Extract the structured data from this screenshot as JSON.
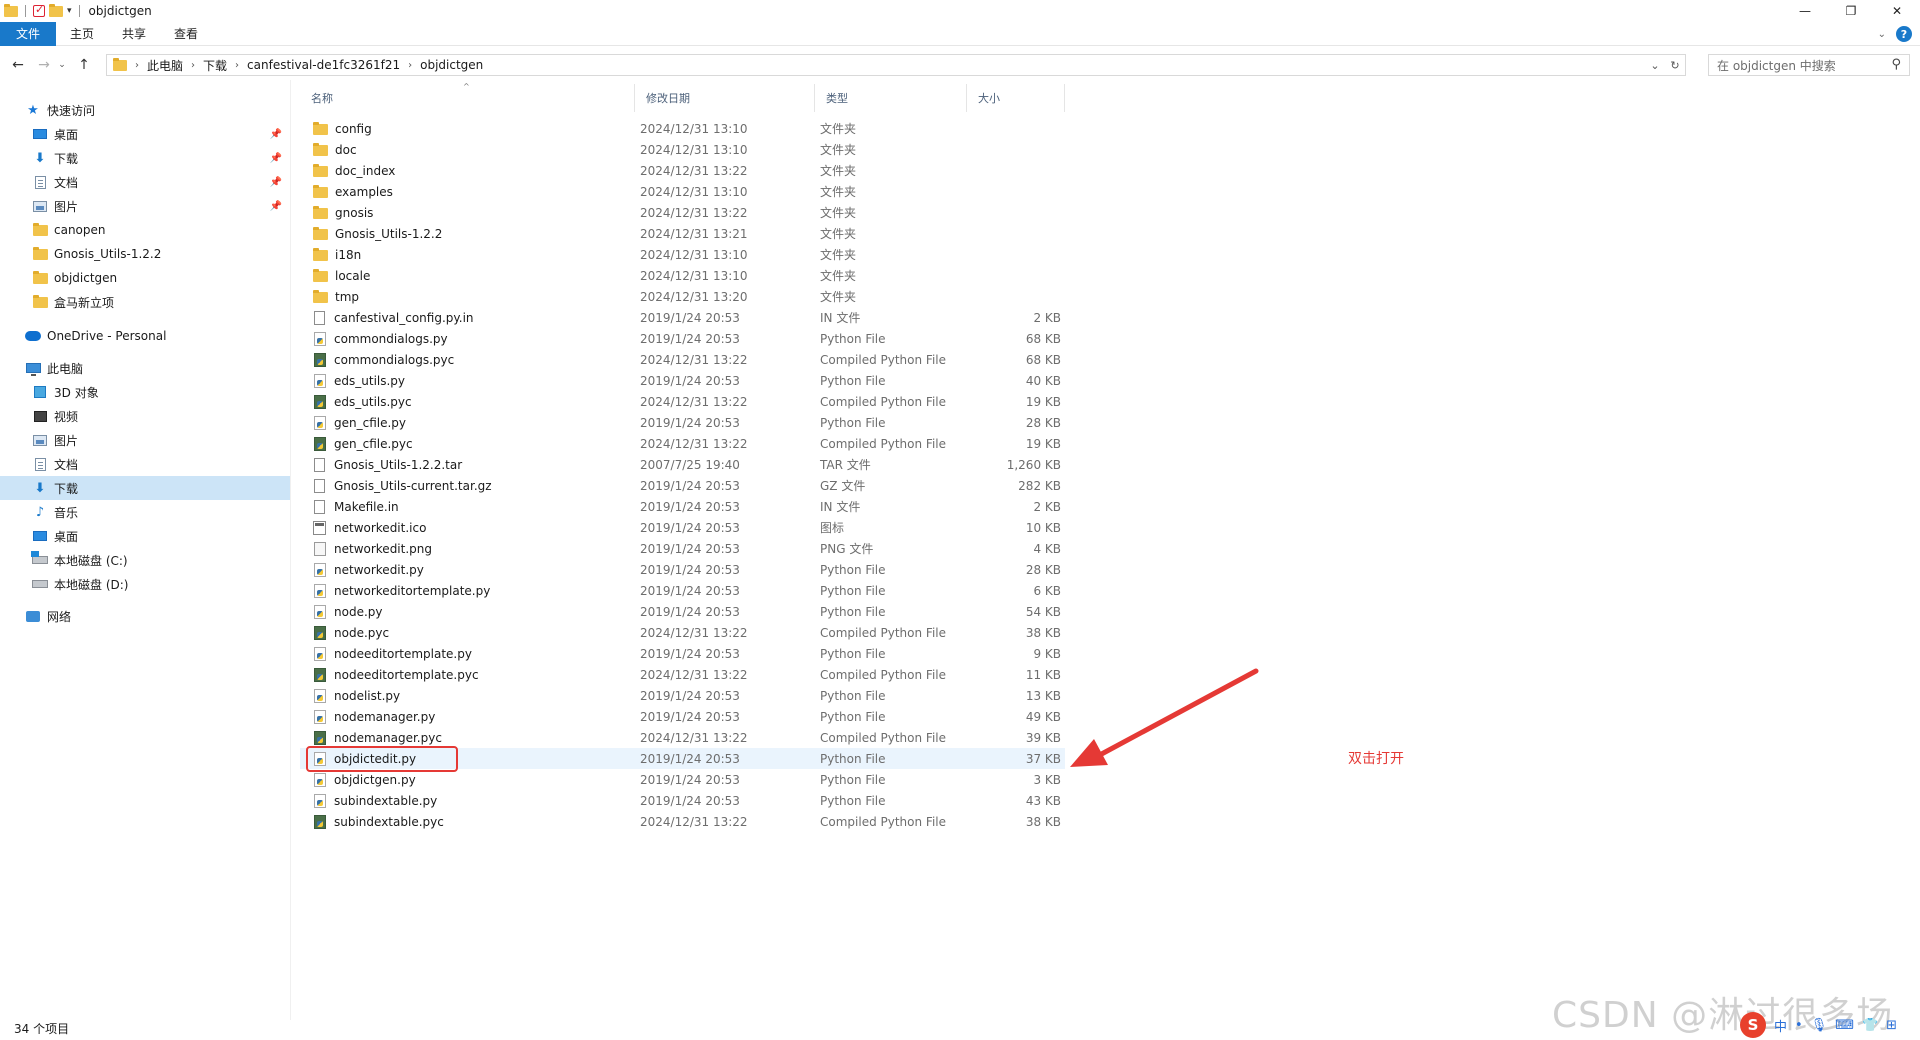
{
  "window": {
    "title": "objdictgen"
  },
  "window_controls": {
    "minimize": "—",
    "restore": "❐",
    "close": "✕"
  },
  "ribbon": {
    "tabs": [
      "文件",
      "主页",
      "共享",
      "查看"
    ],
    "help": "?"
  },
  "address": {
    "crumbs": [
      "此电脑",
      "下载",
      "canfestival-de1fc3261f21",
      "objdictgen"
    ]
  },
  "search": {
    "placeholder": "在 objdictgen 中搜索"
  },
  "sidebar": {
    "quick_access": "快速访问",
    "quick_items": [
      "桌面",
      "下载",
      "文档",
      "图片",
      "canopen",
      "Gnosis_Utils-1.2.2",
      "objdictgen",
      "盒马新立项"
    ],
    "onedrive": "OneDrive - Personal",
    "this_pc": "此电脑",
    "pc_items": [
      "3D 对象",
      "视频",
      "图片",
      "文档",
      "下载",
      "音乐",
      "桌面",
      "本地磁盘 (C:)",
      "本地磁盘 (D:)"
    ],
    "network": "网络"
  },
  "columns": {
    "name": "名称",
    "date": "修改日期",
    "type": "类型",
    "size": "大小"
  },
  "files": [
    {
      "name": "config",
      "date": "2024/12/31 13:10",
      "type": "文件夹",
      "size": "",
      "icon": "folder"
    },
    {
      "name": "doc",
      "date": "2024/12/31 13:10",
      "type": "文件夹",
      "size": "",
      "icon": "folder"
    },
    {
      "name": "doc_index",
      "date": "2024/12/31 13:22",
      "type": "文件夹",
      "size": "",
      "icon": "folder"
    },
    {
      "name": "examples",
      "date": "2024/12/31 13:10",
      "type": "文件夹",
      "size": "",
      "icon": "folder"
    },
    {
      "name": "gnosis",
      "date": "2024/12/31 13:22",
      "type": "文件夹",
      "size": "",
      "icon": "folder"
    },
    {
      "name": "Gnosis_Utils-1.2.2",
      "date": "2024/12/31 13:21",
      "type": "文件夹",
      "size": "",
      "icon": "folder"
    },
    {
      "name": "i18n",
      "date": "2024/12/31 13:10",
      "type": "文件夹",
      "size": "",
      "icon": "folder"
    },
    {
      "name": "locale",
      "date": "2024/12/31 13:10",
      "type": "文件夹",
      "size": "",
      "icon": "folder"
    },
    {
      "name": "tmp",
      "date": "2024/12/31 13:20",
      "type": "文件夹",
      "size": "",
      "icon": "folder"
    },
    {
      "name": "canfestival_config.py.in",
      "date": "2019/1/24 20:53",
      "type": "IN 文件",
      "size": "2 KB",
      "icon": "blank"
    },
    {
      "name": "commondialogs.py",
      "date": "2019/1/24 20:53",
      "type": "Python File",
      "size": "68 KB",
      "icon": "py"
    },
    {
      "name": "commondialogs.pyc",
      "date": "2024/12/31 13:22",
      "type": "Compiled Python File",
      "size": "68 KB",
      "icon": "pyc"
    },
    {
      "name": "eds_utils.py",
      "date": "2019/1/24 20:53",
      "type": "Python File",
      "size": "40 KB",
      "icon": "py"
    },
    {
      "name": "eds_utils.pyc",
      "date": "2024/12/31 13:22",
      "type": "Compiled Python File",
      "size": "19 KB",
      "icon": "pyc"
    },
    {
      "name": "gen_cfile.py",
      "date": "2019/1/24 20:53",
      "type": "Python File",
      "size": "28 KB",
      "icon": "py"
    },
    {
      "name": "gen_cfile.pyc",
      "date": "2024/12/31 13:22",
      "type": "Compiled Python File",
      "size": "19 KB",
      "icon": "pyc"
    },
    {
      "name": "Gnosis_Utils-1.2.2.tar",
      "date": "2007/7/25 19:40",
      "type": "TAR 文件",
      "size": "1,260 KB",
      "icon": "blank"
    },
    {
      "name": "Gnosis_Utils-current.tar.gz",
      "date": "2019/1/24 20:53",
      "type": "GZ 文件",
      "size": "282 KB",
      "icon": "blank"
    },
    {
      "name": "Makefile.in",
      "date": "2019/1/24 20:53",
      "type": "IN 文件",
      "size": "2 KB",
      "icon": "blank"
    },
    {
      "name": "networkedit.ico",
      "date": "2019/1/24 20:53",
      "type": "图标",
      "size": "10 KB",
      "icon": "ico"
    },
    {
      "name": "networkedit.png",
      "date": "2019/1/24 20:53",
      "type": "PNG 文件",
      "size": "4 KB",
      "icon": "png"
    },
    {
      "name": "networkedit.py",
      "date": "2019/1/24 20:53",
      "type": "Python File",
      "size": "28 KB",
      "icon": "py"
    },
    {
      "name": "networkeditortemplate.py",
      "date": "2019/1/24 20:53",
      "type": "Python File",
      "size": "6 KB",
      "icon": "py"
    },
    {
      "name": "node.py",
      "date": "2019/1/24 20:53",
      "type": "Python File",
      "size": "54 KB",
      "icon": "py"
    },
    {
      "name": "node.pyc",
      "date": "2024/12/31 13:22",
      "type": "Compiled Python File",
      "size": "38 KB",
      "icon": "pyc"
    },
    {
      "name": "nodeeditortemplate.py",
      "date": "2019/1/24 20:53",
      "type": "Python File",
      "size": "9 KB",
      "icon": "py"
    },
    {
      "name": "nodeeditortemplate.pyc",
      "date": "2024/12/31 13:22",
      "type": "Compiled Python File",
      "size": "11 KB",
      "icon": "pyc"
    },
    {
      "name": "nodelist.py",
      "date": "2019/1/24 20:53",
      "type": "Python File",
      "size": "13 KB",
      "icon": "py"
    },
    {
      "name": "nodemanager.py",
      "date": "2019/1/24 20:53",
      "type": "Python File",
      "size": "49 KB",
      "icon": "py"
    },
    {
      "name": "nodemanager.pyc",
      "date": "2024/12/31 13:22",
      "type": "Compiled Python File",
      "size": "39 KB",
      "icon": "pyc"
    },
    {
      "name": "objdictedit.py",
      "date": "2019/1/24 20:53",
      "type": "Python File",
      "size": "37 KB",
      "icon": "py",
      "highlighted": true
    },
    {
      "name": "objdictgen.py",
      "date": "2019/1/24 20:53",
      "type": "Python File",
      "size": "3 KB",
      "icon": "py"
    },
    {
      "name": "subindextable.py",
      "date": "2019/1/24 20:53",
      "type": "Python File",
      "size": "43 KB",
      "icon": "py"
    },
    {
      "name": "subindextable.pyc",
      "date": "2024/12/31 13:22",
      "type": "Compiled Python File",
      "size": "38 KB",
      "icon": "pyc"
    }
  ],
  "annotation": {
    "text": "双击打开",
    "color": "#e53935"
  },
  "status": {
    "count": "34 个项目"
  },
  "watermark": "CSDN @淋过很多场雨",
  "colors": {
    "accent": "#1979ca",
    "selected": "#cce4f7",
    "hover": "#eaf4fd",
    "folder": "#f1c34a"
  }
}
